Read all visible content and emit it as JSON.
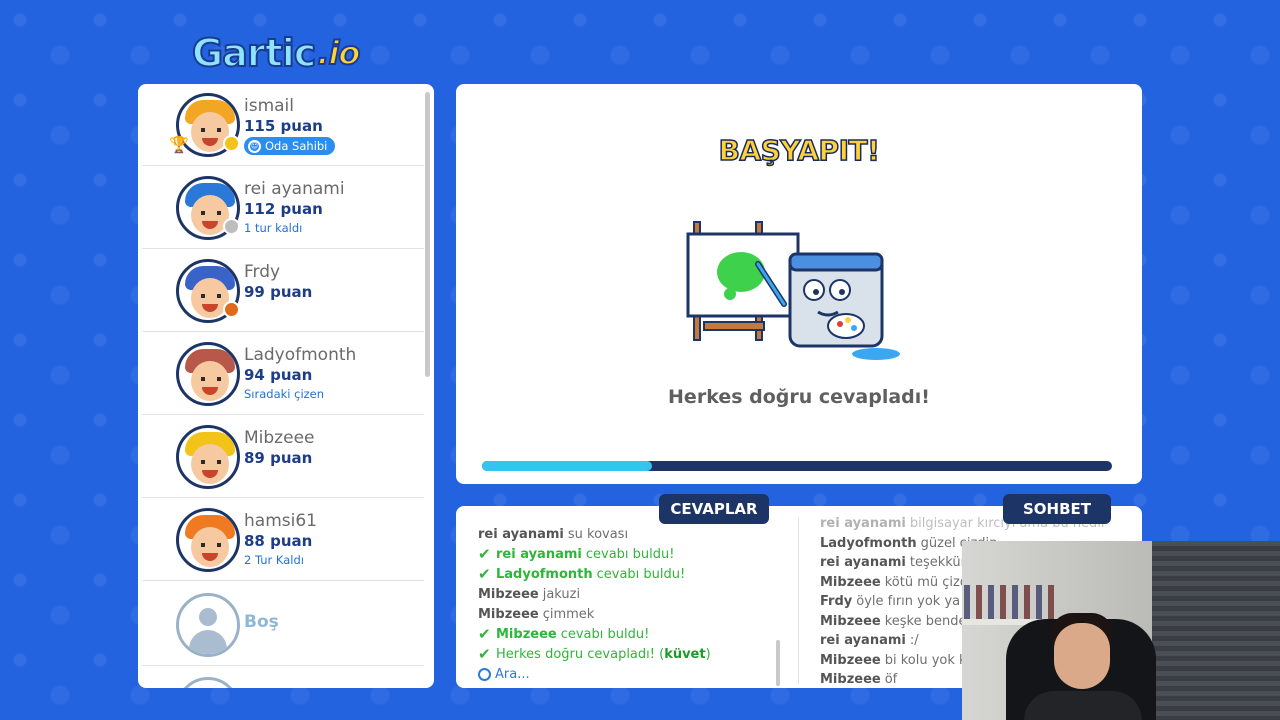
{
  "app": {
    "logo_main": "Gartic",
    "logo_suffix": ".io"
  },
  "players": [
    {
      "name": "ismail",
      "points": "115 puan",
      "badge": "Oda Sahibi",
      "sub": "",
      "hair_color": "#f3a623",
      "status_color": "#f4c21b",
      "trophy": true
    },
    {
      "name": "rei ayanami",
      "points": "112 puan",
      "badge": "",
      "sub": "1 tur kaldı",
      "hair_color": "#2a78d8",
      "status_color": "#bdbdbd",
      "trophy": false
    },
    {
      "name": "Frdy",
      "points": "99 puan",
      "badge": "",
      "sub": "",
      "hair_color": "#3a63c9",
      "status_color": "#e06a1c",
      "trophy": false
    },
    {
      "name": "Ladyofmonth",
      "points": "94 puan",
      "badge": "",
      "sub": "Sıradaki çizen",
      "hair_color": "#b8584a",
      "status_color": "",
      "trophy": false
    },
    {
      "name": "Mibzeee",
      "points": "89 puan",
      "badge": "",
      "sub": "",
      "hair_color": "#f2c318",
      "status_color": "",
      "trophy": false
    },
    {
      "name": "hamsi61",
      "points": "88 puan",
      "badge": "",
      "sub": "2 Tur Kaldı",
      "hair_color": "#f07a22",
      "status_color": "",
      "trophy": false
    }
  ],
  "empty_slot": {
    "label": "Boş"
  },
  "main": {
    "title": "BAŞYAPIT!",
    "message": "Herkes doğru cevapladı!",
    "progress": 0.27
  },
  "tabs": {
    "answers": "CEVAPLAR",
    "chat": "SOHBET"
  },
  "answers": [
    {
      "type": "plain",
      "who": "rei ayanami",
      "text": "su kovası"
    },
    {
      "type": "correct",
      "who": "rei ayanami",
      "text": "cevabı buldu!"
    },
    {
      "type": "correct",
      "who": "Ladyofmonth",
      "text": "cevabı buldu!"
    },
    {
      "type": "plain",
      "who": "Mibzeee",
      "text": "jakuzi"
    },
    {
      "type": "plain",
      "who": "Mibzeee",
      "text": "çimmek"
    },
    {
      "type": "correct",
      "who": "Mibzeee",
      "text": "cevabı buldu!"
    },
    {
      "type": "final",
      "text": "Herkes doğru cevapladı! (",
      "word": "küvet",
      "close": ")"
    },
    {
      "type": "waiting",
      "text": "Ara..."
    }
  ],
  "chat": [
    {
      "who": "rei ayanami",
      "text": "bilgisayar kırcıyı ama bu nedir"
    },
    {
      "who": "Ladyofmonth",
      "text": "güzel çizdin"
    },
    {
      "who": "rei ayanami",
      "text": "teşekkürler"
    },
    {
      "who": "Mibzeee",
      "text": "kötü mü çizdin"
    },
    {
      "who": "Frdy",
      "text": "öyle fırın yok ya"
    },
    {
      "who": "Mibzeee",
      "text": "keşke bende b"
    },
    {
      "who": "rei ayanami",
      "text": ":/"
    },
    {
      "who": "Mibzeee",
      "text": "bi kolu yok ke"
    },
    {
      "who": "Mibzeee",
      "text": "öf"
    }
  ]
}
